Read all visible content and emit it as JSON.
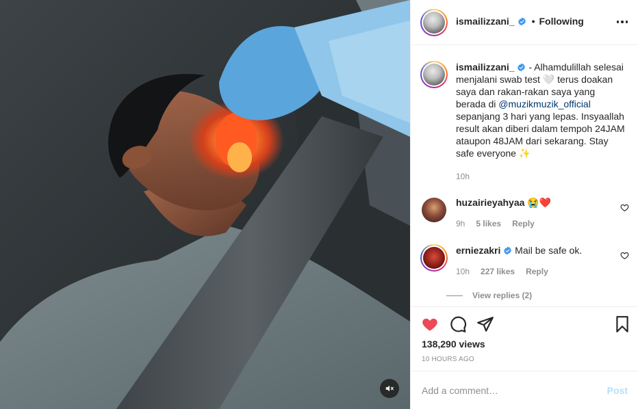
{
  "media": {
    "mute_icon": "speaker-muted-icon"
  },
  "header": {
    "username": "ismailizzani_",
    "separator": "•",
    "follow_status": "Following",
    "more_icon": "more-horizontal-icon"
  },
  "caption": {
    "username": "ismailizzani_",
    "text_part1": " - Alhamdulillah selesai menjalani swab test 🤍 terus doakan saya dan rakan-rakan saya yang berada di ",
    "mention": "@muzikmuzik_official",
    "text_part2": " sepanjang 3 hari yang lepas. Insyaallah result akan diberi dalam tempoh 24JAM ataupon 48JAM dari sekarang. Stay safe everyone ✨",
    "time": "10h"
  },
  "comments": [
    {
      "username": "huzairieyahyaa",
      "text": " 😭❤️",
      "time": "9h",
      "likes": "5 likes",
      "reply": "Reply",
      "verified": false
    },
    {
      "username": "erniezakri",
      "text": " Mail be safe ok.",
      "time": "10h",
      "likes": "227 likes",
      "reply": "Reply",
      "verified": true,
      "view_replies": "View replies (2)"
    }
  ],
  "actions": {
    "like_icon": "heart-filled-icon",
    "comment_icon": "comment-icon",
    "share_icon": "paper-plane-icon",
    "save_icon": "bookmark-icon",
    "views": "138,290 views",
    "time_ago": "10 HOURS AGO"
  },
  "comment_box": {
    "placeholder": "Add a comment…",
    "post_label": "Post"
  },
  "colors": {
    "like_red": "#ed4956",
    "verified_blue": "#3897f0",
    "link_blue": "#00376b",
    "muted_gray": "#8e8e8e",
    "post_disabled": "#b2dffc"
  }
}
